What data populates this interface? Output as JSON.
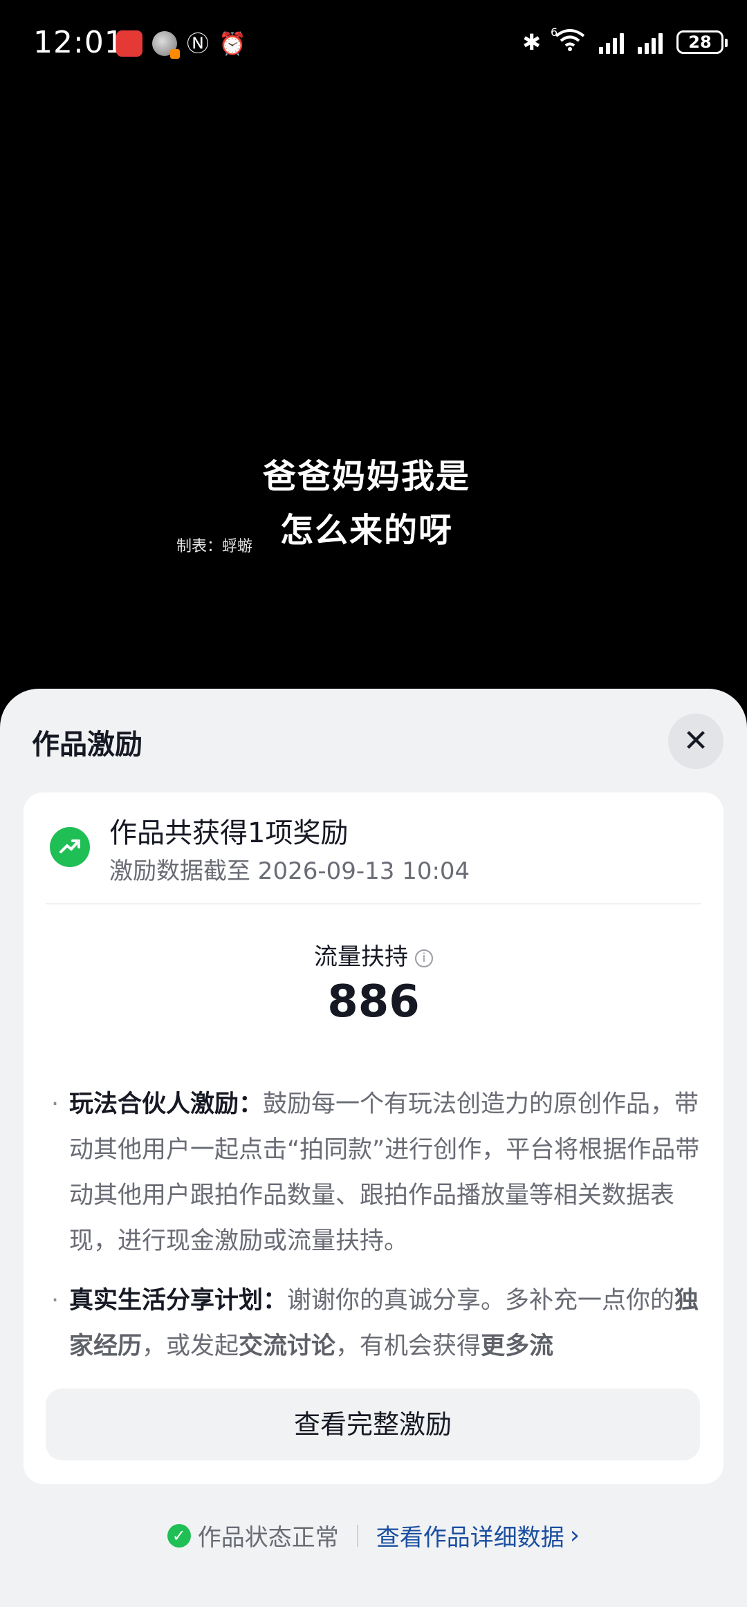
{
  "status_bar": {
    "time": "12:01",
    "wifi_label": "6",
    "battery": "28"
  },
  "video": {
    "title_line1": "爸爸妈妈我是",
    "title_line2": "怎么来的呀",
    "credit": "制表：蜉蝣"
  },
  "sheet": {
    "title": "作品激励",
    "close_icon": "close-icon",
    "summary": {
      "title": "作品共获得1项奖励",
      "subtitle": "激励数据截至 2026-09-13 10:04"
    },
    "metric": {
      "label": "流量扶持",
      "value": "886"
    },
    "descriptions": [
      {
        "title": "玩法合伙人激励：",
        "text": "鼓励每一个有玩法创造力的原创作品，带动其他用户一起点击“拍同款”进行创作，平台将根据作品带动其他用户跟拍作品数量、跟拍作品播放量等相关数据表现，进行现金激励或流量扶持。"
      },
      {
        "title": "真实生活分享计划：",
        "text_a": "谢谢你的真诚分享。多补充一点你的",
        "bold_a": "独家经历",
        "text_b": "，或发起",
        "bold_b": "交流讨论",
        "text_c": "，有机会获得",
        "bold_c": "更多流"
      }
    ],
    "full_button": "查看完整激励",
    "footer": {
      "status": "作品状态正常",
      "detail_link": "查看作品详细数据"
    }
  },
  "colors": {
    "accent_green": "#20bf55",
    "link_blue": "#1a4fa0",
    "text_primary": "#161823",
    "text_secondary": "#6a6c75"
  }
}
